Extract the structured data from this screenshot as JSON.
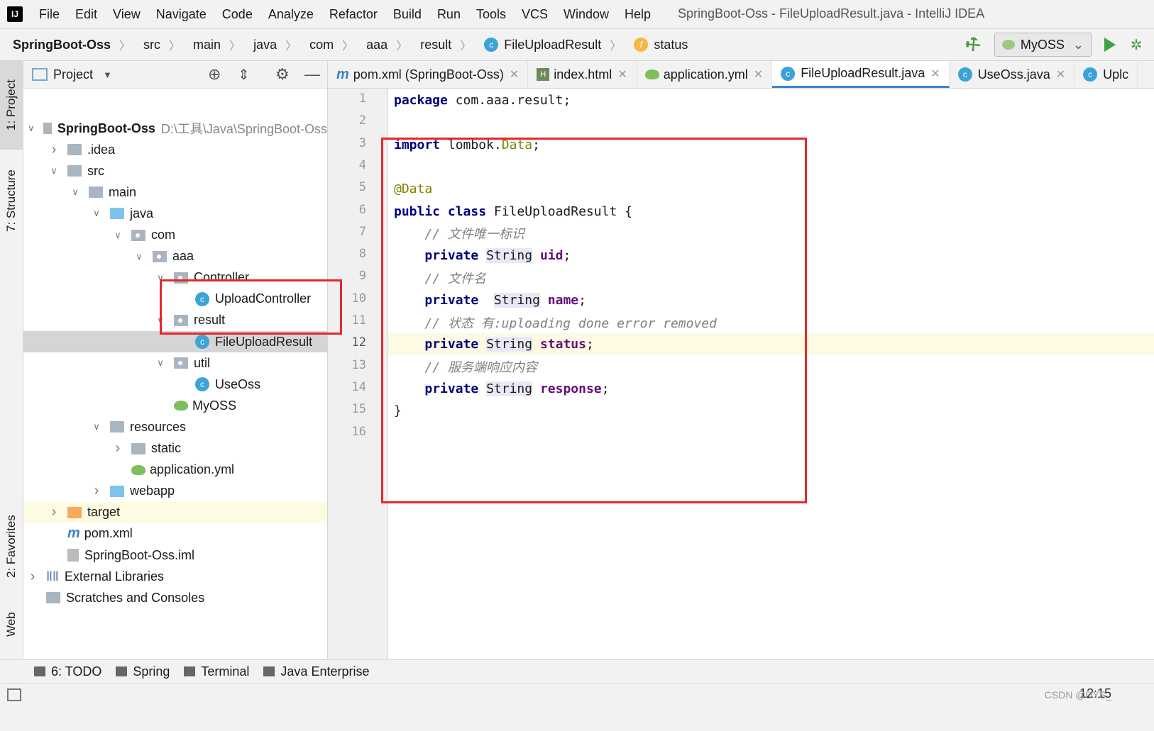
{
  "window": {
    "title": "SpringBoot-Oss - FileUploadResult.java - IntelliJ IDEA",
    "menu": [
      "File",
      "Edit",
      "View",
      "Navigate",
      "Code",
      "Analyze",
      "Refactor",
      "Build",
      "Run",
      "Tools",
      "VCS",
      "Window",
      "Help"
    ]
  },
  "breadcrumb": {
    "items": [
      "SpringBoot-Oss",
      "src",
      "main",
      "java",
      "com",
      "aaa",
      "result",
      "FileUploadResult",
      "status"
    ],
    "run_config": "MyOSS"
  },
  "left_stripe": {
    "project_tab": "1: Project",
    "structure_tab": "7: Structure",
    "favorites_tab": "2: Favorites",
    "web_tab": "Web"
  },
  "project_panel": {
    "title": "Project",
    "root_path": "D:\\工具\\Java\\SpringBoot-Oss",
    "tree": [
      {
        "label": "SpringBoot-Oss",
        "depth": 0,
        "expanded": true,
        "kind": "module"
      },
      {
        "label": ".idea",
        "depth": 1,
        "expanded": false,
        "kind": "folder"
      },
      {
        "label": "src",
        "depth": 1,
        "expanded": true,
        "kind": "folder"
      },
      {
        "label": "main",
        "depth": 2,
        "expanded": true,
        "kind": "folder"
      },
      {
        "label": "java",
        "depth": 3,
        "expanded": true,
        "kind": "source"
      },
      {
        "label": "com",
        "depth": 4,
        "expanded": true,
        "kind": "package"
      },
      {
        "label": "aaa",
        "depth": 5,
        "expanded": true,
        "kind": "package"
      },
      {
        "label": "Controller",
        "depth": 6,
        "expanded": true,
        "kind": "package"
      },
      {
        "label": "UploadController",
        "depth": 7,
        "kind": "class"
      },
      {
        "label": "result",
        "depth": 6,
        "expanded": true,
        "kind": "package"
      },
      {
        "label": "FileUploadResult",
        "depth": 7,
        "kind": "class",
        "selected": true
      },
      {
        "label": "util",
        "depth": 6,
        "expanded": true,
        "kind": "package"
      },
      {
        "label": "UseOss",
        "depth": 7,
        "kind": "class"
      },
      {
        "label": "MyOSS",
        "depth": 6,
        "kind": "springboot"
      },
      {
        "label": "resources",
        "depth": 3,
        "expanded": true,
        "kind": "resources"
      },
      {
        "label": "static",
        "depth": 4,
        "expanded": false,
        "kind": "folder"
      },
      {
        "label": "application.yml",
        "depth": 4,
        "kind": "yml"
      },
      {
        "label": "webapp",
        "depth": 3,
        "expanded": false,
        "kind": "web"
      },
      {
        "label": "target",
        "depth": 1,
        "expanded": false,
        "kind": "excluded"
      },
      {
        "label": "pom.xml",
        "depth": 1,
        "kind": "maven"
      },
      {
        "label": "SpringBoot-Oss.iml",
        "depth": 1,
        "kind": "iml"
      },
      {
        "label": "External Libraries",
        "depth": 0,
        "expanded": false,
        "kind": "libs"
      },
      {
        "label": "Scratches and Consoles",
        "depth": 0,
        "kind": "scratch"
      }
    ]
  },
  "editor_tabs": [
    {
      "label": "pom.xml (SpringBoot-Oss)",
      "icon": "maven-icon"
    },
    {
      "label": "index.html",
      "icon": "html-icon"
    },
    {
      "label": "application.yml",
      "icon": "yml-icon"
    },
    {
      "label": "FileUploadResult.java",
      "icon": "class-icon",
      "active": true
    },
    {
      "label": "UseOss.java",
      "icon": "class-icon"
    },
    {
      "label": "Uplc",
      "icon": "class-icon"
    }
  ],
  "editor": {
    "current_line": 12,
    "lines": [
      [
        {
          "t": "package",
          "c": "kw"
        },
        {
          "t": " com.aaa.result;"
        }
      ],
      [],
      [
        {
          "t": "import",
          "c": "kw"
        },
        {
          "t": " lombok."
        },
        {
          "t": "Data",
          "c": "ann"
        },
        {
          "t": ";"
        }
      ],
      [],
      [
        {
          "t": "@Data",
          "c": "ann"
        }
      ],
      [
        {
          "t": "public class",
          "c": "kw"
        },
        {
          "t": " FileUploadResult {"
        }
      ],
      [
        {
          "t": "    "
        },
        {
          "t": "// 文件唯一标识",
          "c": "cmt"
        }
      ],
      [
        {
          "t": "    "
        },
        {
          "t": "private",
          "c": "kw"
        },
        {
          "t": " "
        },
        {
          "t": "String",
          "c": "typ"
        },
        {
          "t": " "
        },
        {
          "t": "uid",
          "c": "fld"
        },
        {
          "t": ";"
        }
      ],
      [
        {
          "t": "    "
        },
        {
          "t": "// 文件名",
          "c": "cmt"
        }
      ],
      [
        {
          "t": "    "
        },
        {
          "t": "private",
          "c": "kw"
        },
        {
          "t": "  "
        },
        {
          "t": "String",
          "c": "typ"
        },
        {
          "t": " "
        },
        {
          "t": "name",
          "c": "fld"
        },
        {
          "t": ";"
        }
      ],
      [
        {
          "t": "    "
        },
        {
          "t": "// 状态 有:uploading done error removed",
          "c": "cmt"
        }
      ],
      [
        {
          "t": "    "
        },
        {
          "t": "private",
          "c": "kw"
        },
        {
          "t": " "
        },
        {
          "t": "String",
          "c": "typ"
        },
        {
          "t": " "
        },
        {
          "t": "status",
          "c": "fld"
        },
        {
          "t": ";"
        }
      ],
      [
        {
          "t": "    "
        },
        {
          "t": "// 服务端响应内容",
          "c": "cmt"
        }
      ],
      [
        {
          "t": "    "
        },
        {
          "t": "private",
          "c": "kw"
        },
        {
          "t": " "
        },
        {
          "t": "String",
          "c": "typ"
        },
        {
          "t": " "
        },
        {
          "t": "response",
          "c": "fld"
        },
        {
          "t": ";"
        }
      ],
      [
        {
          "t": "}"
        }
      ],
      []
    ]
  },
  "bottom_tools": [
    {
      "label": "6: TODO",
      "icon": "todo-icon"
    },
    {
      "label": "Spring",
      "icon": "spring-icon"
    },
    {
      "label": "Terminal",
      "icon": "terminal-icon"
    },
    {
      "label": "Java Enterprise",
      "icon": "java-enterprise-icon"
    }
  ],
  "status_bar": {
    "clock": "12:15",
    "watermark": "CSDN @DYS_"
  },
  "colors": {
    "highlight_box": "#e8262b",
    "selection": "#d5d5d5",
    "caret_row": "#fffae3",
    "keyword": "#000080"
  }
}
